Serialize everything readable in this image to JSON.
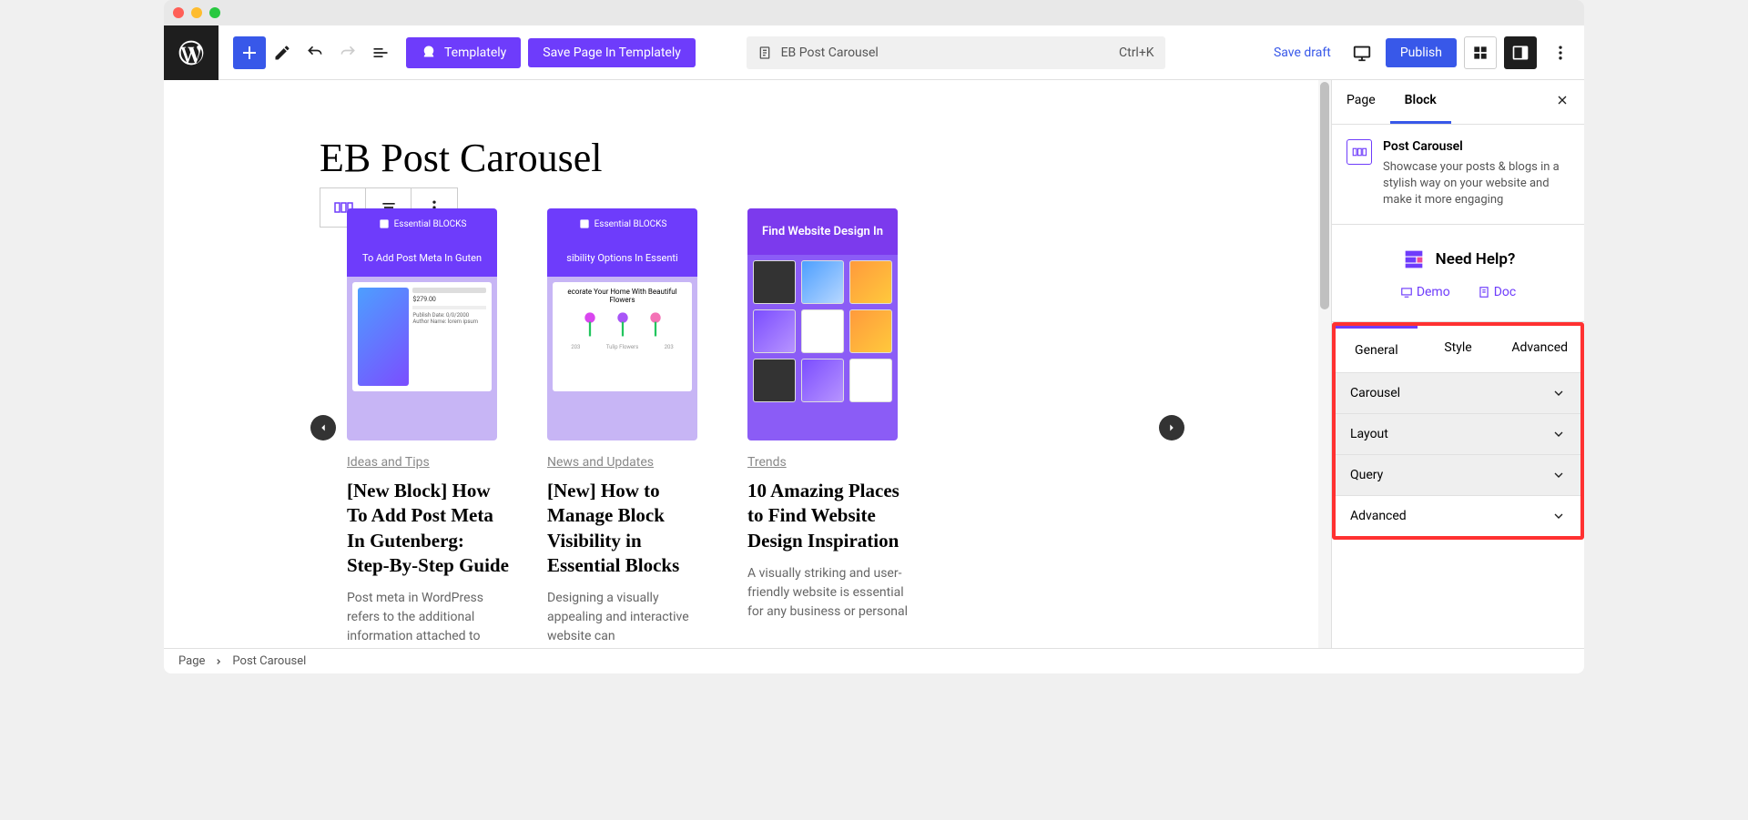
{
  "topbar": {
    "templately_btn": "Templately",
    "save_template_btn": "Save Page In Templately",
    "doc_title": "EB Post Carousel",
    "shortcut": "Ctrl+K",
    "save_draft": "Save draft",
    "publish": "Publish"
  },
  "page": {
    "title": "EB Post Carousel"
  },
  "carousel": {
    "cards": [
      {
        "badge": "Essential BLOCKS",
        "header": "To Add Post Meta In Guten",
        "category": "Ideas and Tips",
        "title": "[New Block] How To Add Post Meta In Gutenberg: Step-By-Step Guide",
        "desc": "Post meta in WordPress refers to the additional information attached to"
      },
      {
        "badge": "Essential BLOCKS",
        "header": "sibility Options In Essenti",
        "thumb_title": "ecorate Your Home With Beautiful Flowers",
        "category": "News and Updates",
        "title": "[New] How to Manage Block Visibility in Essential Blocks",
        "desc": "Designing a visually appealing and interactive website can"
      },
      {
        "header": "Find Website Design In",
        "category": "Trends",
        "title": "10 Amazing Places to Find Website Design Inspiration",
        "desc": "A visually striking and user-friendly website is essential for any business or personal"
      }
    ]
  },
  "sidebar": {
    "tabs": {
      "page": "Page",
      "block": "Block"
    },
    "block_info": {
      "name": "Post Carousel",
      "desc": "Showcase your posts & blogs in a stylish way on your website and make it more engaging"
    },
    "help": {
      "title": "Need Help?",
      "demo": "Demo",
      "doc": "Doc"
    },
    "inner_tabs": {
      "general": "General",
      "style": "Style",
      "advanced": "Advanced"
    },
    "accordions": {
      "carousel": "Carousel",
      "layout": "Layout",
      "query": "Query",
      "advanced": "Advanced"
    }
  },
  "footer": {
    "crumb1": "Page",
    "crumb2": "Post Carousel"
  }
}
